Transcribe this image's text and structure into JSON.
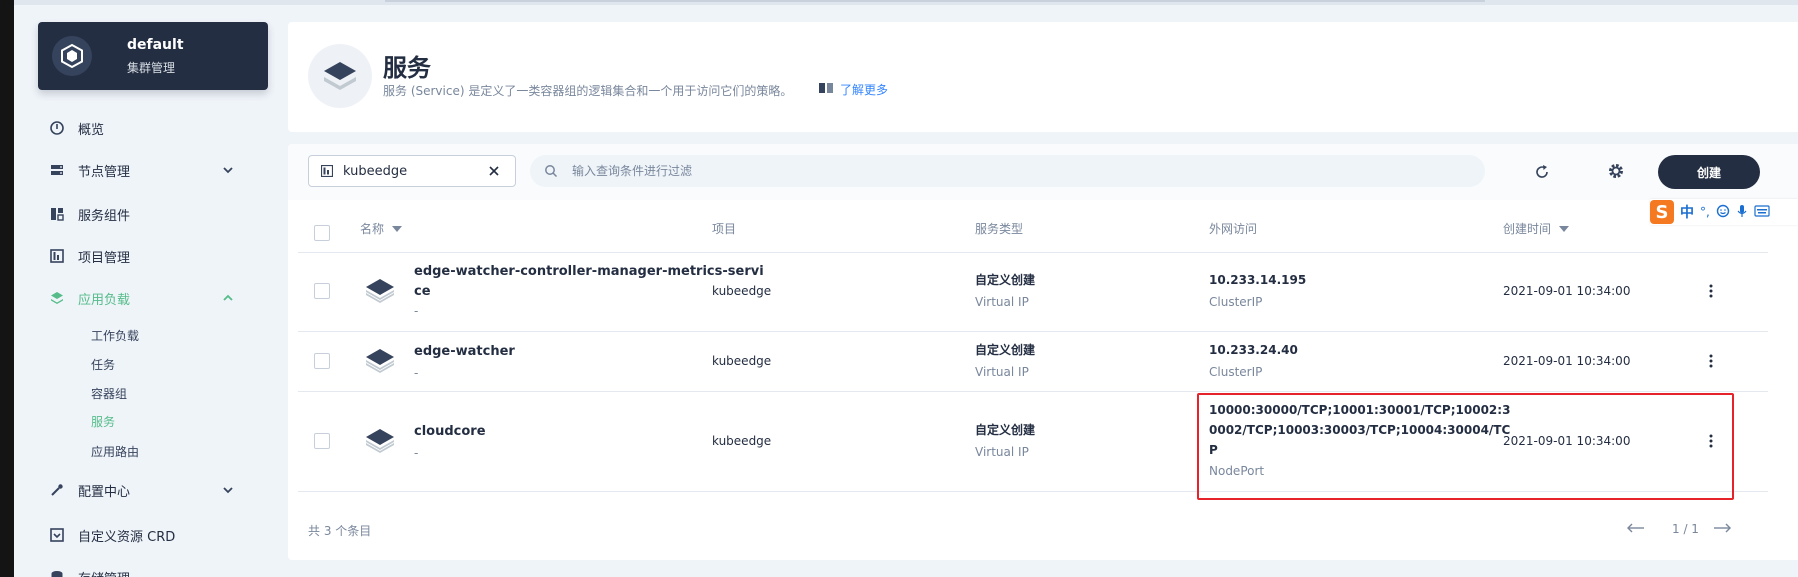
{
  "cluster": {
    "name": "default",
    "subtitle": "集群管理"
  },
  "nav": {
    "items": [
      {
        "label": "概览",
        "icon": "dashboard-icon"
      },
      {
        "label": "节点管理",
        "icon": "server-icon",
        "chevron": "down"
      },
      {
        "label": "服务组件",
        "icon": "components-icon"
      },
      {
        "label": "项目管理",
        "icon": "project-icon"
      },
      {
        "label": "应用负载",
        "icon": "layers-icon",
        "chevron": "up",
        "active": true
      },
      {
        "label": "配置中心",
        "icon": "wrench-icon",
        "chevron": "down"
      },
      {
        "label": "自定义资源 CRD",
        "icon": "crd-icon"
      },
      {
        "label": "存储管理",
        "icon": "storage-icon"
      }
    ],
    "sub_items": [
      "工作负载",
      "任务",
      "容器组",
      "服务",
      "应用路由"
    ],
    "active_sub": "服务"
  },
  "header": {
    "title": "服务",
    "description": "服务 (Service) 是定义了一类容器组的逻辑集合和一个用于访问它们的策略。",
    "learn_more": "了解更多"
  },
  "toolbar": {
    "namespace": "kubeedge",
    "search_placeholder": "输入查询条件进行过滤",
    "create_label": "创建"
  },
  "ime": {
    "logo": "S",
    "mode": "中",
    "punct": "°,"
  },
  "table": {
    "columns": {
      "name": "名称",
      "project": "项目",
      "type": "服务类型",
      "access": "外网访问",
      "created": "创建时间"
    },
    "rows": [
      {
        "name_line1": "edge-watcher-controller-manager-metrics-servi",
        "name_line2": "ce",
        "desc": "-",
        "project": "kubeedge",
        "type": "自定义创建",
        "type_sub": "Virtual IP",
        "access": "10.233.14.195",
        "access_sub": "ClusterIP",
        "created": "2021-09-01 10:34:00"
      },
      {
        "name_line1": "edge-watcher",
        "desc": "-",
        "project": "kubeedge",
        "type": "自定义创建",
        "type_sub": "Virtual IP",
        "access": "10.233.24.40",
        "access_sub": "ClusterIP",
        "created": "2021-09-01 10:34:00"
      },
      {
        "name_line1": "cloudcore",
        "desc": "-",
        "project": "kubeedge",
        "type": "自定义创建",
        "type_sub": "Virtual IP",
        "access_lines": [
          "10000:30000/TCP;10001:30001/TCP;10002:3",
          "0002/TCP;10003:30003/TCP;10004:30004/TC",
          "P"
        ],
        "access_sub": "NodePort",
        "created": "2021-09-01 10:34:00"
      }
    ]
  },
  "footer": {
    "count": "共 3 个条目",
    "page": "1 / 1"
  },
  "colors": {
    "accent": "#55bc8a",
    "dark": "#242e42",
    "highlight_border": "#e6222a"
  }
}
